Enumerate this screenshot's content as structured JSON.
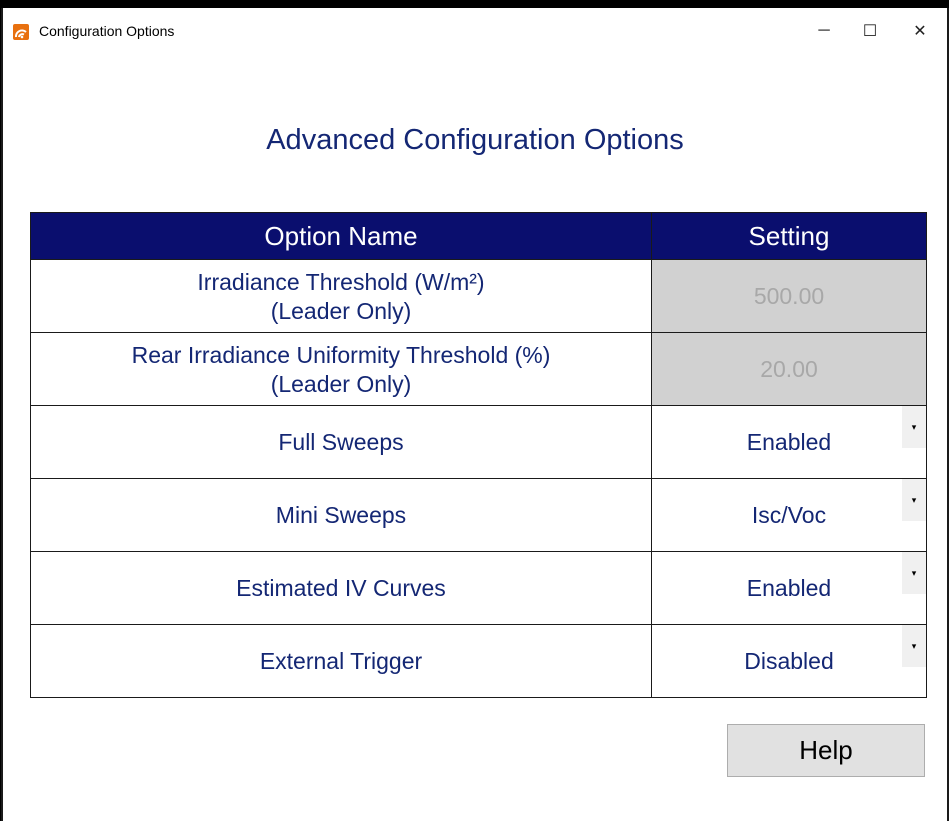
{
  "window": {
    "title": "Configuration Options",
    "controls": {
      "minimize": "─",
      "maximize": "☐",
      "close": "✕"
    }
  },
  "heading": "Advanced Configuration Options",
  "table": {
    "headers": {
      "name": "Option Name",
      "setting": "Setting"
    },
    "threshold_rows": [
      {
        "name_line1": "Irradiance Threshold (W/m²)",
        "name_line2": "(Leader Only)",
        "value": "500.00"
      },
      {
        "name_line1": "Rear Irradiance Uniformity Threshold (%)",
        "name_line2": "(Leader Only)",
        "value": "20.00"
      }
    ],
    "select_rows": [
      {
        "name": "Full Sweeps",
        "value": "Enabled"
      },
      {
        "name": "Mini Sweeps",
        "value": "Isc/Voc"
      },
      {
        "name": "Estimated IV Curves",
        "value": "Enabled"
      },
      {
        "name": "External Trigger",
        "value": "Disabled"
      }
    ],
    "dropdown_arrow": "▾"
  },
  "help_button": "Help",
  "colors": {
    "header_bg": "#0a0e6e",
    "text_blue": "#142774",
    "disabled_bg": "#d1d1d1",
    "disabled_text": "#a8a8a8",
    "button_bg": "#e1e1e1",
    "app_icon": "#e8700f"
  }
}
